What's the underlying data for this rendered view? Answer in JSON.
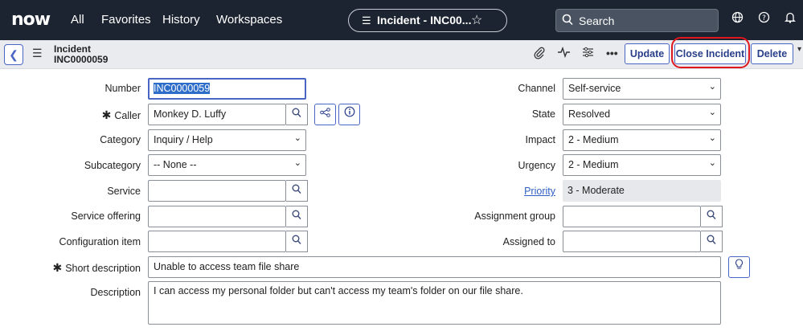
{
  "topnav": {
    "logo": "now",
    "items": [
      "All",
      "Favorites",
      "History",
      "Workspaces"
    ],
    "context_pill": "Incident - INC00...",
    "search_placeholder": "Search"
  },
  "header": {
    "record_type": "Incident",
    "record_number": "INC0000059",
    "buttons": {
      "update": "Update",
      "close_incident": "Close Incident",
      "delete": "Delete"
    }
  },
  "form": {
    "number": {
      "label": "Number",
      "value": "INC0000059"
    },
    "caller": {
      "label": "Caller",
      "value": "Monkey D. Luffy"
    },
    "category": {
      "label": "Category",
      "value": "Inquiry / Help"
    },
    "subcategory": {
      "label": "Subcategory",
      "value": "-- None --"
    },
    "service": {
      "label": "Service",
      "value": ""
    },
    "service_offering": {
      "label": "Service offering",
      "value": ""
    },
    "configuration_item": {
      "label": "Configuration item",
      "value": ""
    },
    "short_description": {
      "label": "Short description",
      "value": "Unable to access team file share"
    },
    "description": {
      "label": "Description",
      "value": "I can access my personal folder but can't access my team's folder on our file share."
    },
    "channel": {
      "label": "Channel",
      "value": "Self-service"
    },
    "state": {
      "label": "State",
      "value": "Resolved"
    },
    "impact": {
      "label": "Impact",
      "value": "2 - Medium"
    },
    "urgency": {
      "label": "Urgency",
      "value": "2 - Medium"
    },
    "priority": {
      "label": "Priority",
      "value": "3 - Moderate"
    },
    "assignment_group": {
      "label": "Assignment group",
      "value": ""
    },
    "assigned_to": {
      "label": "Assigned to",
      "value": ""
    }
  }
}
